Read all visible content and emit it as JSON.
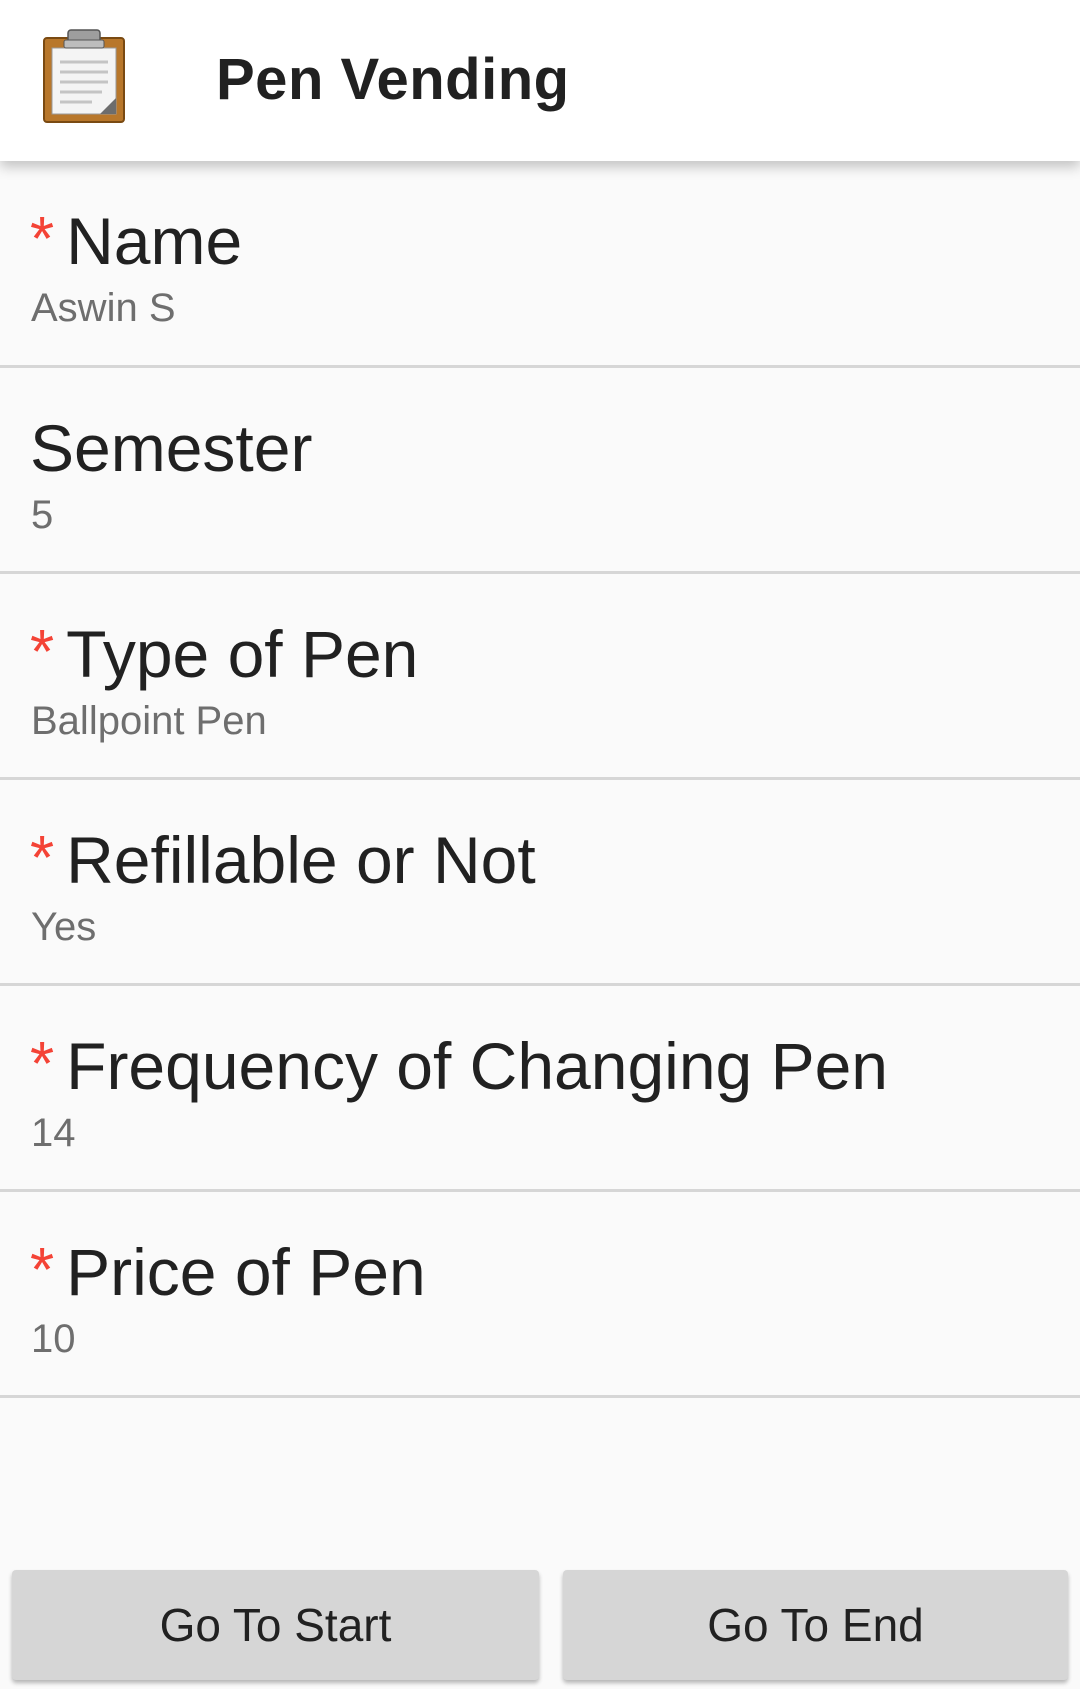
{
  "app_bar": {
    "title": "Pen Vending",
    "icon": "clipboard-icon"
  },
  "questions": [
    {
      "required": true,
      "label": "Name",
      "answer": "Aswin S"
    },
    {
      "required": false,
      "label": "Semester",
      "answer": "5"
    },
    {
      "required": true,
      "label": "Type of Pen",
      "answer": "Ballpoint Pen"
    },
    {
      "required": true,
      "label": "Refillable or Not",
      "answer": "Yes"
    },
    {
      "required": true,
      "label": "Frequency of Changing Pen",
      "answer": "14"
    },
    {
      "required": true,
      "label": "Price of Pen",
      "answer": "10"
    }
  ],
  "required_marker": "*",
  "buttons": {
    "go_to_start": "Go To Start",
    "go_to_end": "Go To End"
  },
  "colors": {
    "required": "#f44336",
    "background": "#fafafa",
    "button": "#d6d6d6"
  }
}
